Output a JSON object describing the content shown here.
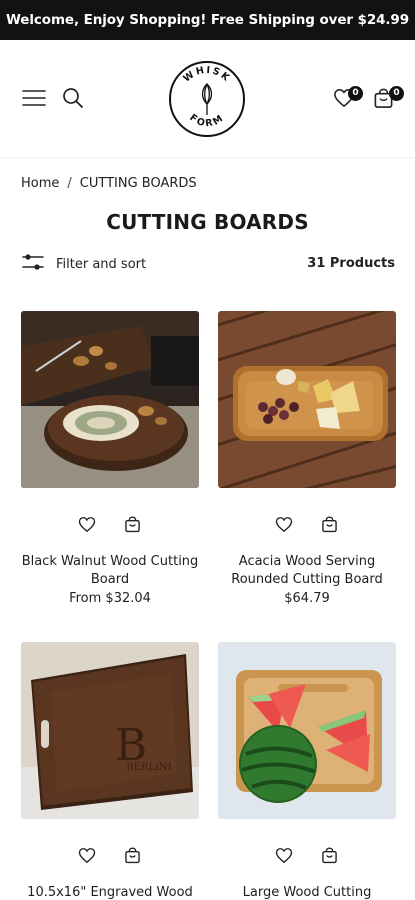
{
  "announcement": "Welcome, Enjoy Shopping! Free Shipping over $24.99",
  "header": {
    "logo_text": "WHISK FORM",
    "wishlist_count": "0",
    "cart_count": "0"
  },
  "breadcrumb": {
    "home": "Home",
    "separator": "/",
    "current": "CUTTING BOARDS"
  },
  "page_title": "CUTTING BOARDS",
  "filter_label": "Filter and sort",
  "product_count": "31 Products",
  "products": [
    {
      "name": "Black Walnut Wood Cutting Board",
      "price": "From $32.04"
    },
    {
      "name": "Acacia Wood Serving Rounded Cutting Board",
      "price": "$64.79"
    },
    {
      "name": "10.5x16\" Engraved Wood",
      "price": ""
    },
    {
      "name": "Large Wood Cutting",
      "price": ""
    }
  ],
  "engraving": {
    "letter": "B",
    "word": "BERLINI"
  }
}
